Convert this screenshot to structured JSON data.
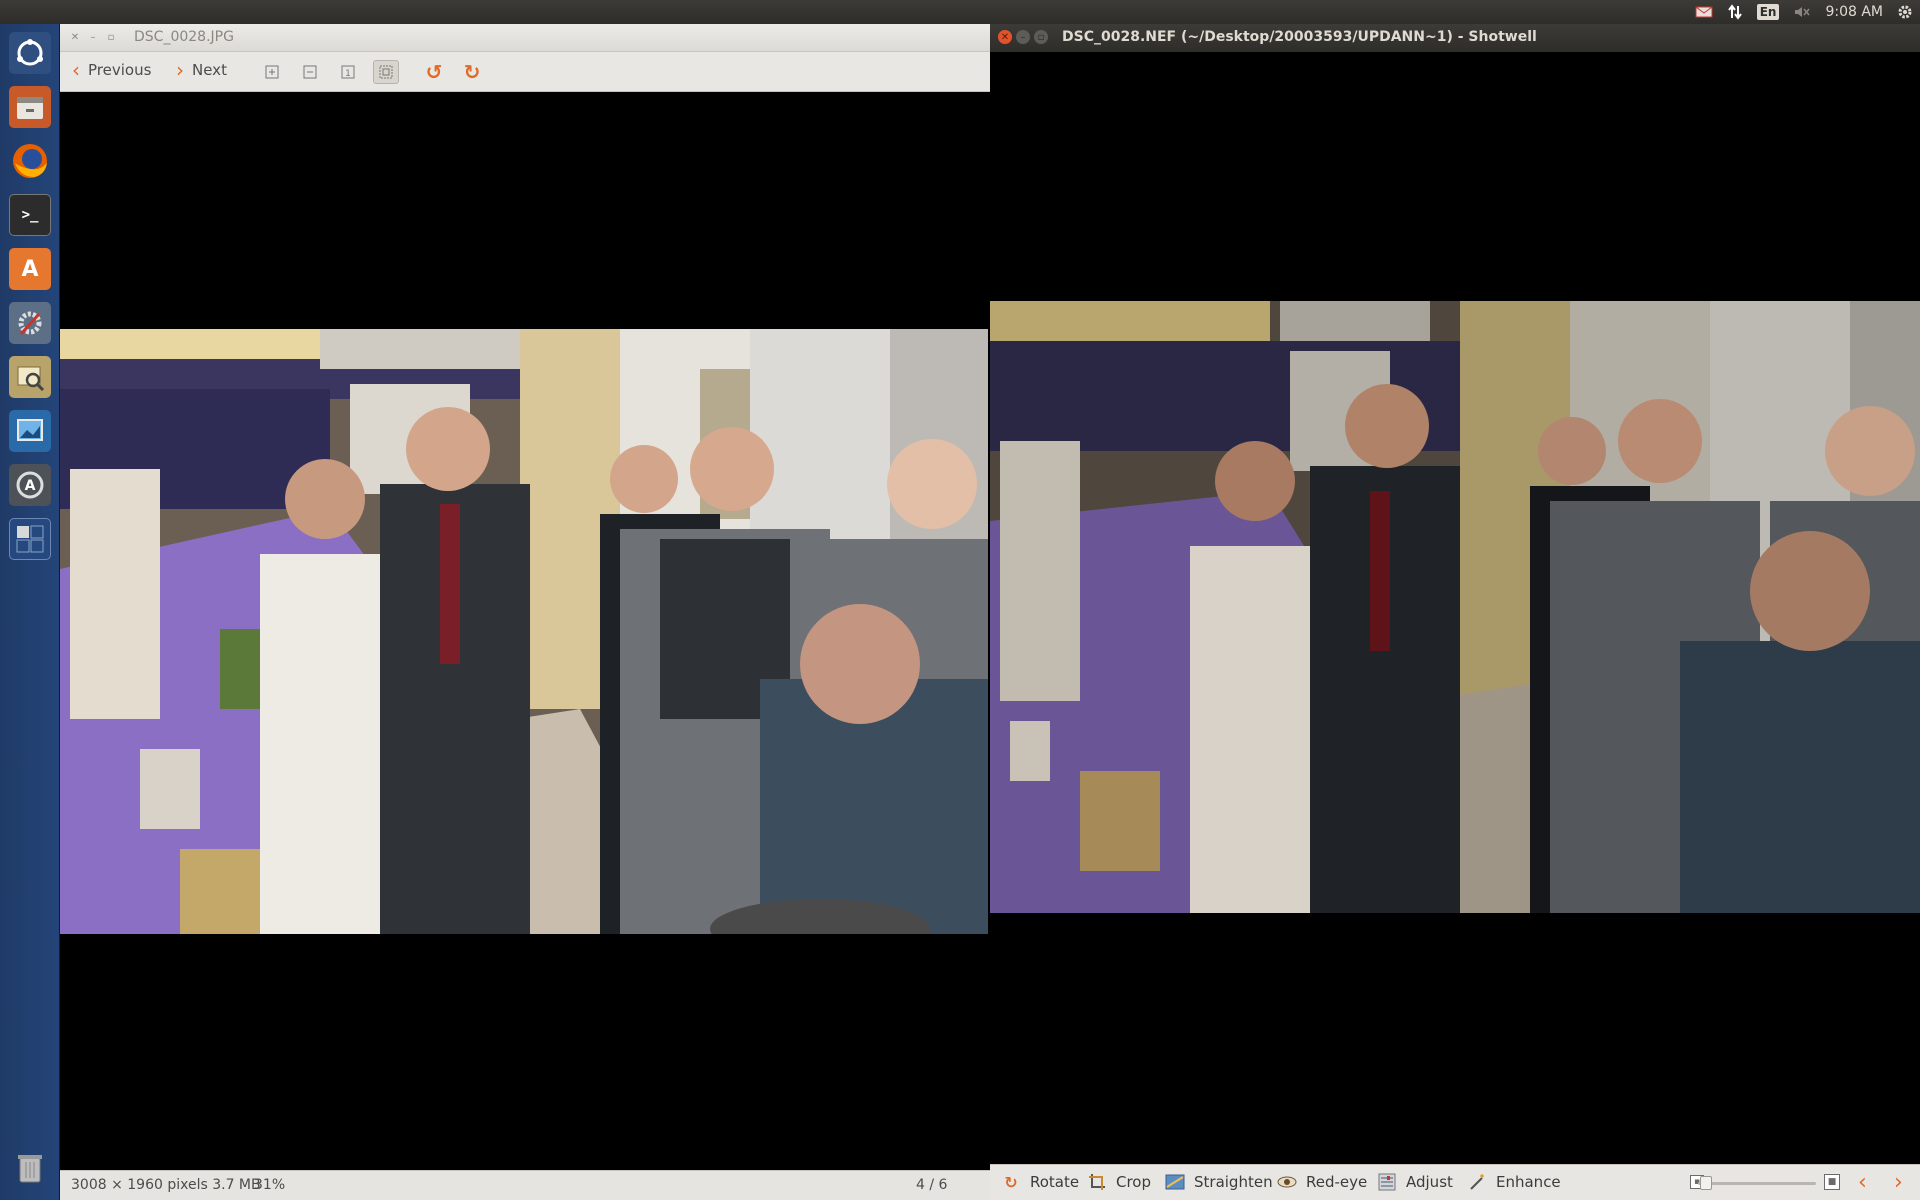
{
  "top_panel": {
    "keyboard_layout": "En",
    "clock": "9:08 AM"
  },
  "launcher": {
    "items": [
      {
        "name": "ubuntu-dash-icon"
      },
      {
        "name": "files-icon"
      },
      {
        "name": "firefox-icon"
      },
      {
        "name": "terminal-icon"
      },
      {
        "name": "software-center-icon"
      },
      {
        "name": "system-settings-icon"
      },
      {
        "name": "image-viewer-icon"
      },
      {
        "name": "shotwell-icon"
      },
      {
        "name": "software-updater-icon"
      },
      {
        "name": "workspace-switcher-icon"
      },
      {
        "name": "trash-icon"
      }
    ]
  },
  "viewer": {
    "title": "DSC_0028.JPG",
    "previous_label": "Previous",
    "next_label": "Next",
    "status": {
      "info": "3008 × 1960 pixels  3.7 MB",
      "zoom": "31%",
      "page": "4 / 6"
    }
  },
  "shotwell": {
    "title": "DSC_0028.NEF (~/Desktop/20003593/UPDANN~1) - Shotwell",
    "tools": {
      "rotate": "Rotate",
      "crop": "Crop",
      "straighten": "Straighten",
      "redeye": "Red-eye",
      "adjust": "Adjust",
      "enhance": "Enhance"
    },
    "zoom_level": 0.02
  },
  "colors": {
    "accent_orange": "#e06a28",
    "tablecloth_purple": "#8a6fc4",
    "uniform_gray": "#6e7276"
  }
}
